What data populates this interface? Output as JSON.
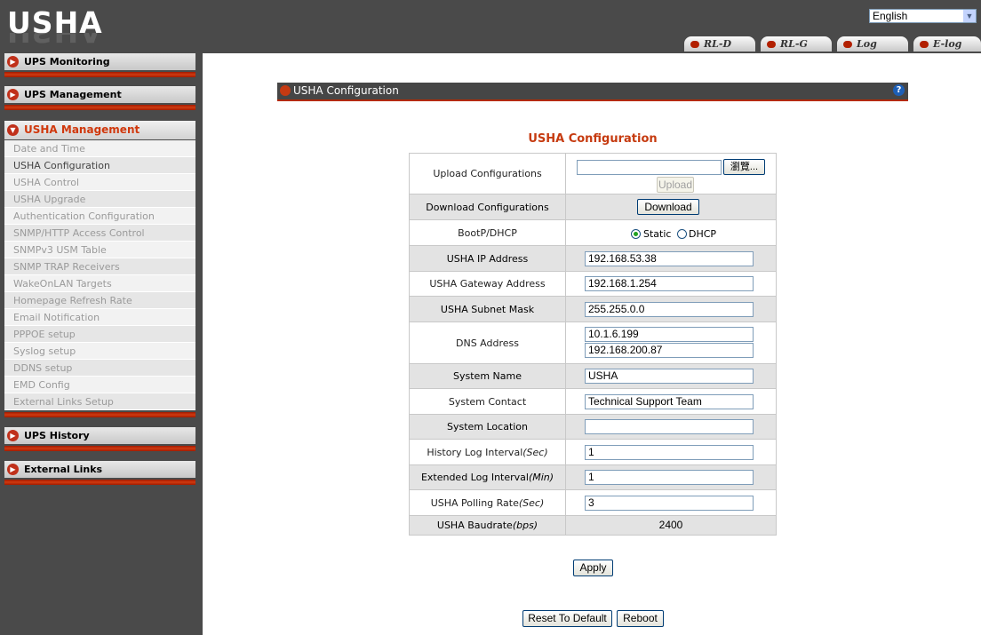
{
  "header": {
    "logo": "USHA",
    "language": "English",
    "links": [
      "RL-D",
      "RL-G",
      "Log",
      "E-log"
    ]
  },
  "sidebar": {
    "sections": [
      "UPS Monitoring",
      "UPS Management",
      "USHA Management",
      "UPS History",
      "External Links"
    ],
    "menu": [
      "Date and Time",
      "USHA Configuration",
      "USHA Control",
      "USHA Upgrade",
      "Authentication Configuration",
      "SNMP/HTTP Access Control",
      "SNMPv3 USM Table",
      "SNMP TRAP Receivers",
      "WakeOnLAN Targets",
      "Homepage Refresh Rate",
      "Email Notification",
      "PPPOE setup",
      "Syslog setup",
      "DDNS setup",
      "EMD Config",
      "External Links Setup"
    ]
  },
  "panel": {
    "title": "USHA Configuration",
    "help": "?"
  },
  "config": {
    "title": "USHA Configuration",
    "labels": {
      "upload": "Upload Configurations",
      "download": "Download Configurations",
      "bootp": "BootP/DHCP",
      "ip": "USHA IP Address",
      "gateway": "USHA Gateway Address",
      "subnet": "USHA Subnet Mask",
      "dns": "DNS Address",
      "sysname": "System Name",
      "contact": "System Contact",
      "location": "System Location",
      "history_log": "History Log Interval",
      "history_log_unit": "(Sec)",
      "ext_log": "Extended Log Interval",
      "ext_log_unit": "(Min)",
      "polling": "USHA Polling Rate",
      "polling_unit": "(Sec)",
      "baud": "USHA Baudrate",
      "baud_unit": "(bps)"
    },
    "browse_label": "瀏覽...",
    "upload_label": "Upload",
    "download_label": "Download",
    "static_label": "Static",
    "dhcp_label": "DHCP",
    "values": {
      "ip": "192.168.53.38",
      "gateway": "192.168.1.254",
      "subnet": "255.255.0.0",
      "dns1": "10.1.6.199",
      "dns2": "192.168.200.87",
      "sysname": "USHA",
      "contact": "Technical Support Team",
      "location": "",
      "history_log": "1",
      "ext_log": "1",
      "polling": "3",
      "baud": "2400"
    }
  },
  "actions": {
    "apply": "Apply",
    "reset": "Reset To Default",
    "reboot": "Reboot"
  }
}
